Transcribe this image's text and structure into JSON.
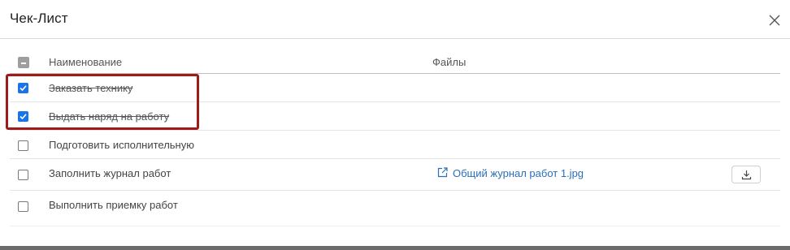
{
  "dialog": {
    "title": "Чек-Лист",
    "close_icon": "close-icon"
  },
  "table": {
    "columns": {
      "name": "Наименование",
      "files": "Файлы"
    },
    "header_checkbox": "indeterminate",
    "rows": [
      {
        "label": "Заказать технику",
        "checked": true,
        "strikethrough": true,
        "file": ""
      },
      {
        "label": "Выдать наряд на работу",
        "checked": true,
        "strikethrough": true,
        "file": ""
      },
      {
        "label": "Подготовить исполнительную",
        "checked": false,
        "strikethrough": false,
        "file": ""
      },
      {
        "label": "Заполнить журнал работ",
        "checked": false,
        "strikethrough": false,
        "file": "Общий журнал работ 1.jpg",
        "file_icon": "external-link-icon",
        "action_icon": "download-icon"
      },
      {
        "label": "Выполнить приемку работ",
        "checked": false,
        "strikethrough": false,
        "file": ""
      }
    ]
  },
  "colors": {
    "checkbox_checked": "#1a73e8",
    "link": "#2a6fb8",
    "highlight_box": "#a11a1a"
  }
}
